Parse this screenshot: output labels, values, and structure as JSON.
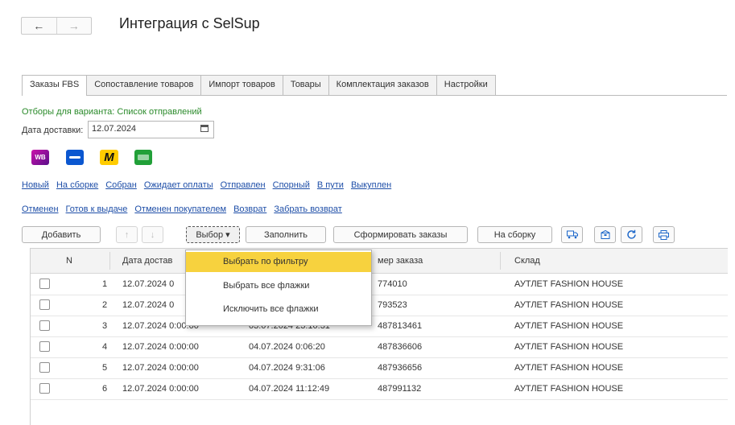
{
  "nav": {
    "back_glyph": "←",
    "forward_glyph": "→"
  },
  "title": "Интеграция с SelSup",
  "tabs": [
    "Заказы FBS",
    "Сопоставление товаров",
    "Импорт товаров",
    "Товары",
    "Комплектация заказов",
    "Настройки"
  ],
  "filters": {
    "caption": "Отборы для варианта: Список отправлений",
    "date_label": "Дата доставки:",
    "date_value": "12.07.2024"
  },
  "marketplaces": [
    {
      "name": "wildberries-logo",
      "text": "WB"
    },
    {
      "name": "ozon-logo"
    },
    {
      "name": "yandex-market-logo",
      "text": "M"
    },
    {
      "name": "sbermegamarket-logo"
    }
  ],
  "status_links_row1": [
    "Новый",
    "На сборке",
    "Собран",
    "Ожидает оплаты",
    "Отправлен",
    "Спорный",
    "В пути",
    "Выкуплен"
  ],
  "status_links_row2": [
    "Отменен",
    "Готов к выдаче",
    "Отменен покупателем",
    "Возврат",
    "Забрать возврат"
  ],
  "toolbar": {
    "add": "Добавить",
    "up_glyph": "↑",
    "down_glyph": "↓",
    "select": "Выбор",
    "select_arrow": "▾",
    "fill": "Заполнить",
    "form_orders": "Сформировать заказы",
    "to_assembly": "На сборку",
    "icons": [
      "truck-icon",
      "box-icon",
      "refresh-icon",
      "print-icon"
    ]
  },
  "table": {
    "headers": {
      "n": "N",
      "delivery_date": "Дата достав",
      "order_number": "мер заказа",
      "warehouse": "Склад"
    },
    "rows": [
      {
        "n": "1",
        "delivery": "12.07.2024 0",
        "created": "",
        "order": "774010",
        "warehouse": "АУТЛЕТ FASHION HOUSE"
      },
      {
        "n": "2",
        "delivery": "12.07.2024 0",
        "created": "",
        "order": "793523",
        "warehouse": "АУТЛЕТ FASHION HOUSE"
      },
      {
        "n": "3",
        "delivery": "12.07.2024 0:00:00",
        "created": "03.07.2024 23:10:31",
        "order": "487813461",
        "warehouse": "АУТЛЕТ FASHION HOUSE"
      },
      {
        "n": "4",
        "delivery": "12.07.2024 0:00:00",
        "created": "04.07.2024 0:06:20",
        "order": "487836606",
        "warehouse": "АУТЛЕТ FASHION HOUSE"
      },
      {
        "n": "5",
        "delivery": "12.07.2024 0:00:00",
        "created": "04.07.2024 9:31:06",
        "order": "487936656",
        "warehouse": "АУТЛЕТ FASHION HOUSE"
      },
      {
        "n": "6",
        "delivery": "12.07.2024 0:00:00",
        "created": "04.07.2024 11:12:49",
        "order": "487991132",
        "warehouse": "АУТЛЕТ FASHION HOUSE"
      }
    ]
  },
  "dropdown": {
    "items": [
      "Выбрать по фильтру",
      "Выбрать все флажки",
      "Исключить все флажки"
    ],
    "highlighted": "Выбрать по фильтру"
  },
  "colors": {
    "accent": "#f7d23e",
    "link": "#1f4fa8",
    "caption_green": "#2a8a2a"
  }
}
